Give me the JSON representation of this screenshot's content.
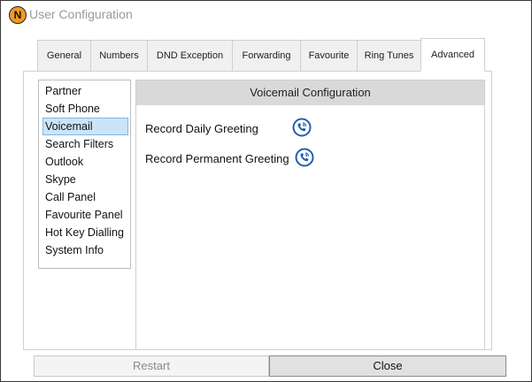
{
  "window": {
    "title": "User Configuration",
    "logo_letter": "N"
  },
  "tabs": [
    {
      "label": "General"
    },
    {
      "label": "Numbers"
    },
    {
      "label": "DND Exception"
    },
    {
      "label": "Forwarding"
    },
    {
      "label": "Favourite"
    },
    {
      "label": "Ring Tunes"
    },
    {
      "label": "Advanced",
      "active": true
    }
  ],
  "sidebar": {
    "items": [
      {
        "label": "Partner"
      },
      {
        "label": "Soft Phone"
      },
      {
        "label": "Voicemail",
        "selected": true
      },
      {
        "label": "Search Filters"
      },
      {
        "label": "Outlook"
      },
      {
        "label": "Skype"
      },
      {
        "label": "Call Panel"
      },
      {
        "label": "Favourite Panel"
      },
      {
        "label": "Hot Key Dialling"
      },
      {
        "label": "System Info"
      }
    ]
  },
  "content": {
    "header": "Voicemail Configuration",
    "rows": [
      {
        "label": "Record Daily Greeting",
        "icon": "phone-call-icon"
      },
      {
        "label": "Record Permanent Greeting",
        "icon": "phone-call-icon"
      }
    ]
  },
  "footer": {
    "restart_label": "Restart",
    "close_label": "Close"
  },
  "colors": {
    "accent_blue": "#1f5fb3",
    "selection_bg": "#cce4f7",
    "header_bg": "#d9d9d9",
    "logo_orange": "#f29a1f"
  }
}
